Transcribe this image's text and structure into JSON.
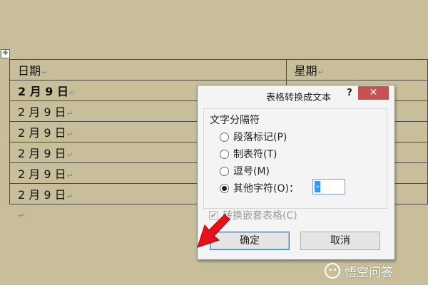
{
  "document": {
    "move_handle_icon": "move-cross-icon",
    "header": {
      "col1": "日期",
      "col2": "星期"
    },
    "rows": [
      {
        "date": "2 月 9 日",
        "bold": true
      },
      {
        "date": "2 月 9 日"
      },
      {
        "date": "2 月 9 日"
      },
      {
        "date": "2 月 9 日"
      },
      {
        "date": "2 月 9 日"
      },
      {
        "date": "2 月 9 日"
      }
    ],
    "para_mark": "↵"
  },
  "dialog": {
    "title": "表格转换成文本",
    "help": "?",
    "close": "✕",
    "group_label": "文字分隔符",
    "options": [
      {
        "label": "段落标记(P)",
        "selected": false
      },
      {
        "label": "制表符(T)",
        "selected": false
      },
      {
        "label": "逗号(M)",
        "selected": false
      },
      {
        "label": "其他字符(O)：",
        "selected": true
      }
    ],
    "other_char_value": "-",
    "nested_checkbox": {
      "label": "转换嵌套表格(C)",
      "checked": true,
      "disabled": true
    },
    "ok_label": "确定",
    "cancel_label": "取消"
  },
  "annotation": {
    "arrow_color": "#e8101a"
  },
  "watermark": {
    "text": "悟空问答"
  },
  "colors": {
    "background": "#c8bf9a",
    "close_button": "#c75050"
  }
}
